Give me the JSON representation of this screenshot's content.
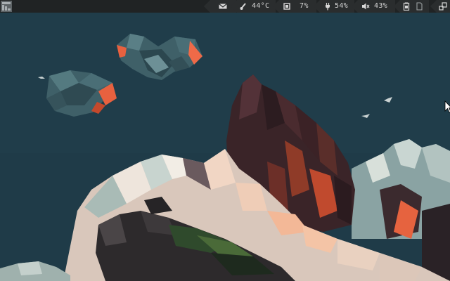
{
  "panel": {
    "launcher_icon": "workspace-logo-icon",
    "mail_icon": "envelope-icon",
    "temperature": {
      "icon": "thermometer-icon",
      "value": "44°C"
    },
    "cpu": {
      "icon": "cpu-icon",
      "value": "7%"
    },
    "battery": {
      "icon": "plug-icon",
      "value": "54%"
    },
    "volume": {
      "icon": "speaker-muted-icon",
      "value": "43%"
    },
    "tray": {
      "icons": [
        "clipboard-icon",
        "sdcard-icon",
        "window-layout-icon"
      ]
    }
  },
  "wallpaper": {
    "description_icon": "lowpoly-landscape-wallpaper",
    "colors": {
      "sky": "#1f3b48",
      "accent": "#ef6a48",
      "rock": "#3a2428",
      "snow": "#e9d9cf"
    }
  }
}
